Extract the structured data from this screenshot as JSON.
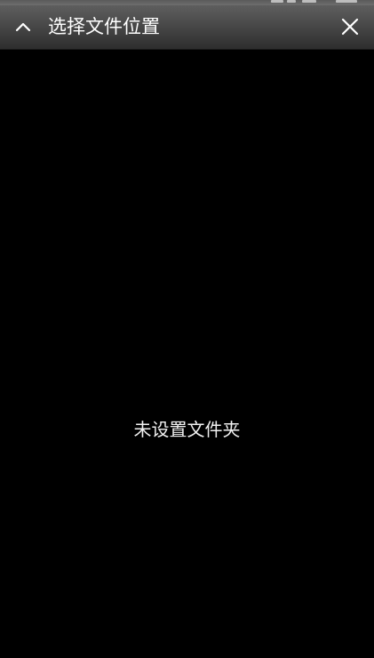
{
  "title_bar": {
    "title": "选择文件位置",
    "collapse_icon": "chevron-up-icon",
    "close_icon": "close-icon"
  },
  "content": {
    "empty_message": "未设置文件夹"
  },
  "colors": {
    "background": "#000000",
    "title_bar_top": "#5e5e5e",
    "title_bar_bottom": "#2e2e2e",
    "text": "#ffffff"
  }
}
